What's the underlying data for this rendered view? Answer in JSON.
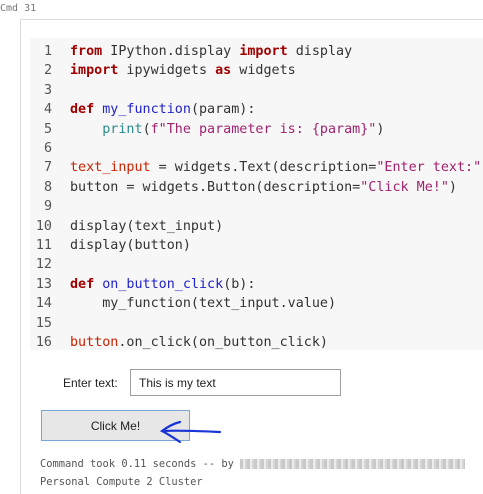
{
  "cell": {
    "label": "Cmd 31"
  },
  "code": {
    "lines": [
      {
        "number": "1",
        "tokens": [
          {
            "t": "from",
            "c": "kw"
          },
          {
            "t": " IPython.display ",
            "c": ""
          },
          {
            "t": "import",
            "c": "kw"
          },
          {
            "t": " display",
            "c": ""
          }
        ]
      },
      {
        "number": "2",
        "tokens": [
          {
            "t": "import",
            "c": "kw"
          },
          {
            "t": " ipywidgets ",
            "c": ""
          },
          {
            "t": "as",
            "c": "kw"
          },
          {
            "t": " widgets",
            "c": ""
          }
        ]
      },
      {
        "number": "3",
        "tokens": []
      },
      {
        "number": "4",
        "tokens": [
          {
            "t": "def",
            "c": "kw"
          },
          {
            "t": " ",
            "c": ""
          },
          {
            "t": "my_function",
            "c": "fn"
          },
          {
            "t": "(param):",
            "c": ""
          }
        ]
      },
      {
        "number": "5",
        "tokens": [
          {
            "t": "    ",
            "c": ""
          },
          {
            "t": "print",
            "c": "nb"
          },
          {
            "t": "(",
            "c": ""
          },
          {
            "t": "f\"The parameter is: {param}\"",
            "c": "st"
          },
          {
            "t": ")",
            "c": ""
          }
        ]
      },
      {
        "number": "6",
        "tokens": []
      },
      {
        "number": "7",
        "tokens": [
          {
            "t": "text_input",
            "c": "vr"
          },
          {
            "t": " = widgets.Text(description=",
            "c": ""
          },
          {
            "t": "\"Enter text:\"",
            "c": "st"
          },
          {
            "t": ")",
            "c": ""
          }
        ]
      },
      {
        "number": "8",
        "tokens": [
          {
            "t": "button = widgets.Button(description=",
            "c": ""
          },
          {
            "t": "\"Click Me!\"",
            "c": "st"
          },
          {
            "t": ")",
            "c": ""
          }
        ]
      },
      {
        "number": "9",
        "tokens": []
      },
      {
        "number": "10",
        "tokens": [
          {
            "t": "display(text_input)",
            "c": ""
          }
        ]
      },
      {
        "number": "11",
        "tokens": [
          {
            "t": "display(button)",
            "c": ""
          }
        ]
      },
      {
        "number": "12",
        "tokens": []
      },
      {
        "number": "13",
        "tokens": [
          {
            "t": "def",
            "c": "kw"
          },
          {
            "t": " ",
            "c": ""
          },
          {
            "t": "on_button_click",
            "c": "fn"
          },
          {
            "t": "(b):",
            "c": ""
          }
        ]
      },
      {
        "number": "14",
        "tokens": [
          {
            "t": "    my_function(text_input.value)",
            "c": ""
          }
        ]
      },
      {
        "number": "15",
        "tokens": []
      },
      {
        "number": "16",
        "tokens": [
          {
            "t": "button",
            "c": "vr"
          },
          {
            "t": ".on_click(on_button_click)",
            "c": ""
          }
        ]
      }
    ]
  },
  "widgets": {
    "text_label": "Enter text:",
    "text_value": "This is my text",
    "button_label": "Click Me!"
  },
  "status": {
    "took": "Command took 0.11 seconds -- by",
    "cluster": "Personal Compute 2 Cluster"
  },
  "colors": {
    "keyword": "#a00000",
    "function_name": "#2222cc",
    "string": "#a0226f",
    "annotation_arrow": "#1a35d6"
  }
}
